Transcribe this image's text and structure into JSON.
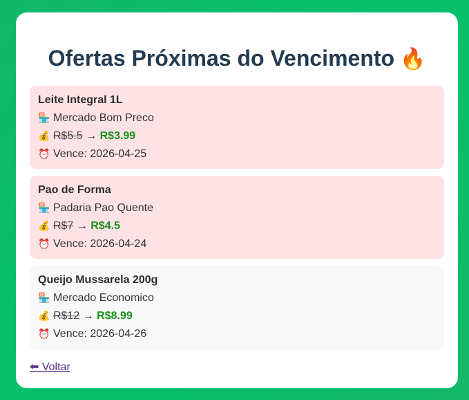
{
  "page": {
    "title": "Ofertas Próximas do Vencimento",
    "title_icon": "🔥"
  },
  "icons": {
    "store": "🏪",
    "money": "💰",
    "clock": "⏰"
  },
  "offers": [
    {
      "name": "Leite Integral 1L",
      "store": "Mercado Bom Preco",
      "old_price": "R$5.5",
      "arrow": "→",
      "new_price": "R$3.99",
      "expires": "Vence: 2026-04-25",
      "status": "urgent"
    },
    {
      "name": "Pao de Forma",
      "store": "Padaria Pao Quente",
      "old_price": "R$7",
      "arrow": "→",
      "new_price": "R$4.5",
      "expires": "Vence: 2026-04-24",
      "status": "urgent"
    },
    {
      "name": "Queijo Mussarela 200g",
      "store": "Mercado Economico",
      "old_price": "R$12",
      "arrow": "→",
      "new_price": "R$8.99",
      "expires": "Vence: 2026-04-26",
      "status": "normal"
    }
  ],
  "back_link": {
    "label": "⬅ Voltar"
  },
  "colors": {
    "background": "#05c06a",
    "urgent_bg": "#fde3e5",
    "normal_bg": "#f8f8f8",
    "new_price": "#1a8f1a",
    "title": "#243b50",
    "link": "#5a2a86"
  }
}
